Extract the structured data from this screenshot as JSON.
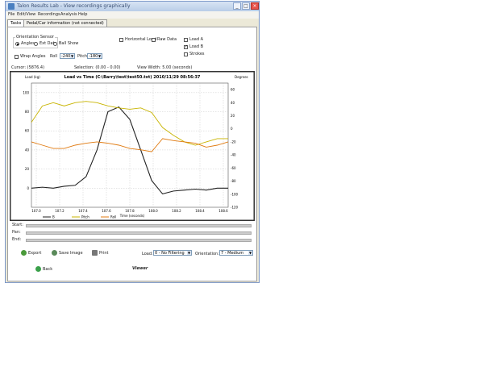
{
  "window": {
    "title": "Talon Results Lab - View recordings graphically"
  },
  "menu": [
    "File",
    "Edit/View",
    "Recordings",
    "Analysis",
    "Help"
  ],
  "tabs": [
    "Tasks",
    "Pedal/Car information (not connected)"
  ],
  "controls": {
    "orientation_group": "Orientation Sensor",
    "orientation_options": [
      "Angles",
      "Ext Data",
      "Ball Show"
    ],
    "orientation_selected": "Angles",
    "checkboxes_mid": [
      {
        "label": "Horizontal Load",
        "checked": false
      },
      {
        "label": "Raw Data",
        "checked": false
      }
    ],
    "checkboxes_right": [
      {
        "label": "Load A",
        "checked": false
      },
      {
        "label": "Load B",
        "checked": true
      },
      {
        "label": "Strokes",
        "checked": false
      }
    ],
    "wrap_angles_label": "Wrap Angles",
    "roll_label": "Roll",
    "roll_value": "-240",
    "pitch_label": "Pitch",
    "pitch_value": "-180"
  },
  "status": {
    "cursor": "Cursor: (5876.4)",
    "selection": "Selection: (0.00 - 0.00)",
    "view_width": "View Width: 5.00 (seconds)"
  },
  "chart_data": {
    "type": "line",
    "title": "Load vs Time (C:\\Barry\\test\\test50.txt) 2010/11/29 08:56:37",
    "ylabel_left": "Load (kg)",
    "ylabel_right": "Degrees",
    "xlabel": "Time (seconds)",
    "x_ticks": [
      "107.0",
      "107.2",
      "107.4",
      "107.6",
      "107.8",
      "108.0",
      "108.2",
      "108.4",
      "108.6"
    ],
    "y_left_ticks": [
      100,
      80,
      60,
      40,
      20,
      0
    ],
    "y_left_lim": [
      -20,
      110
    ],
    "y_right_ticks": [
      60,
      40,
      20,
      0,
      -20,
      -40,
      -60,
      -80,
      -100,
      -120
    ],
    "y_right_lim": [
      -120,
      70
    ],
    "grid": true,
    "x": [
      106.9,
      107.0,
      107.1,
      107.2,
      107.3,
      107.4,
      107.5,
      107.6,
      107.7,
      107.8,
      107.9,
      108.0,
      108.1,
      108.2,
      108.3,
      108.4,
      108.5,
      108.6,
      108.7
    ],
    "series": [
      {
        "name": "B",
        "color": "#222222",
        "axis": "left",
        "values": [
          0,
          1,
          0,
          2,
          3,
          12,
          40,
          80,
          85,
          72,
          40,
          8,
          -6,
          -3,
          -2,
          -1,
          -2,
          0,
          0
        ]
      },
      {
        "name": "Pitch",
        "color": "#c8b400",
        "axis": "right",
        "values": [
          10,
          35,
          40,
          35,
          40,
          42,
          40,
          35,
          32,
          30,
          32,
          25,
          2,
          -10,
          -20,
          -25,
          -20,
          -15,
          -15
        ]
      },
      {
        "name": "Roll",
        "color": "#e07a10",
        "axis": "right",
        "values": [
          -20,
          -25,
          -30,
          -30,
          -25,
          -22,
          -20,
          -22,
          -25,
          -30,
          -32,
          -35,
          -15,
          -18,
          -20,
          -22,
          -28,
          -25,
          -20
        ]
      }
    ]
  },
  "sliders": [
    "Start:",
    "Pan:",
    "End:"
  ],
  "bottom": {
    "export_label": "Export",
    "save_image_label": "Save Image",
    "print_label": "Print",
    "load_label": "Load:",
    "load_value": "0 - No Filtering",
    "orientation_label": "Orientation:",
    "orientation_value": "7 - Medium",
    "back_label": "Back",
    "footer_title": "Viewer"
  },
  "colors": {
    "titlebar": "#c7d7ee",
    "close_button": "#e8534a",
    "line_b": "#222222",
    "line_pitch": "#c8b400",
    "line_roll": "#e07a10"
  }
}
